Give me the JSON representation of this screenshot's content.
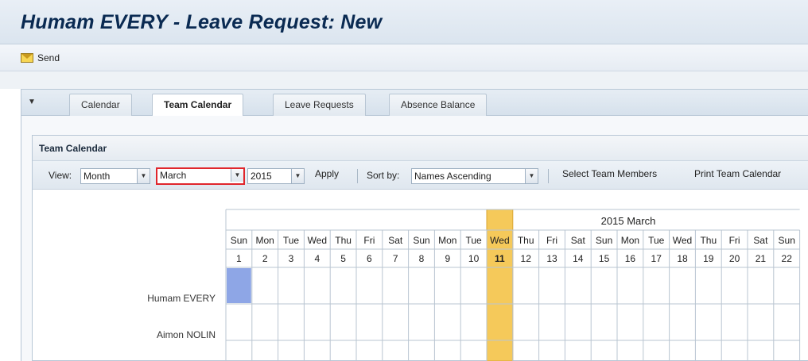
{
  "app": {
    "title": "Humam EVERY - Leave Request: New"
  },
  "toolbar": {
    "send_label": "Send",
    "send_icon": "envelope-icon"
  },
  "tabs": [
    {
      "label": "Calendar",
      "active": false
    },
    {
      "label": "Team Calendar",
      "active": true
    },
    {
      "label": "Leave Requests",
      "active": false
    },
    {
      "label": "Absence Balance",
      "active": false
    }
  ],
  "team_calendar": {
    "title": "Team Calendar",
    "view_label": "View:",
    "view_value": "Month",
    "month_value": "March",
    "year_value": "2015",
    "apply_label": "Apply",
    "sort_label": "Sort by:",
    "sort_value": "Names Ascending",
    "select_members_label": "Select Team Members",
    "print_label": "Print Team Calendar"
  },
  "calendar": {
    "header": "2015 March",
    "days": [
      {
        "dow": "Sun",
        "day": "1"
      },
      {
        "dow": "Mon",
        "day": "2"
      },
      {
        "dow": "Tue",
        "day": "3"
      },
      {
        "dow": "Wed",
        "day": "4"
      },
      {
        "dow": "Thu",
        "day": "5"
      },
      {
        "dow": "Fri",
        "day": "6"
      },
      {
        "dow": "Sat",
        "day": "7"
      },
      {
        "dow": "Sun",
        "day": "8"
      },
      {
        "dow": "Mon",
        "day": "9"
      },
      {
        "dow": "Tue",
        "day": "10"
      },
      {
        "dow": "Wed",
        "day": "11"
      },
      {
        "dow": "Thu",
        "day": "12"
      },
      {
        "dow": "Fri",
        "day": "13"
      },
      {
        "dow": "Sat",
        "day": "14"
      },
      {
        "dow": "Sun",
        "day": "15"
      },
      {
        "dow": "Mon",
        "day": "16"
      },
      {
        "dow": "Tue",
        "day": "17"
      },
      {
        "dow": "Wed",
        "day": "18"
      },
      {
        "dow": "Thu",
        "day": "19"
      },
      {
        "dow": "Fri",
        "day": "20"
      },
      {
        "dow": "Sat",
        "day": "21"
      },
      {
        "dow": "Sun",
        "day": "22"
      }
    ],
    "today_index": 10,
    "members": [
      "Humam EVERY",
      "Aimon NOLIN"
    ],
    "selected_cell": {
      "member_index": 0,
      "day_index": 0
    },
    "colors": {
      "today": "#f5c95a",
      "today_border": "#d9a534",
      "selected": "#8ea6e6",
      "grid": "#b9c5d1"
    }
  }
}
